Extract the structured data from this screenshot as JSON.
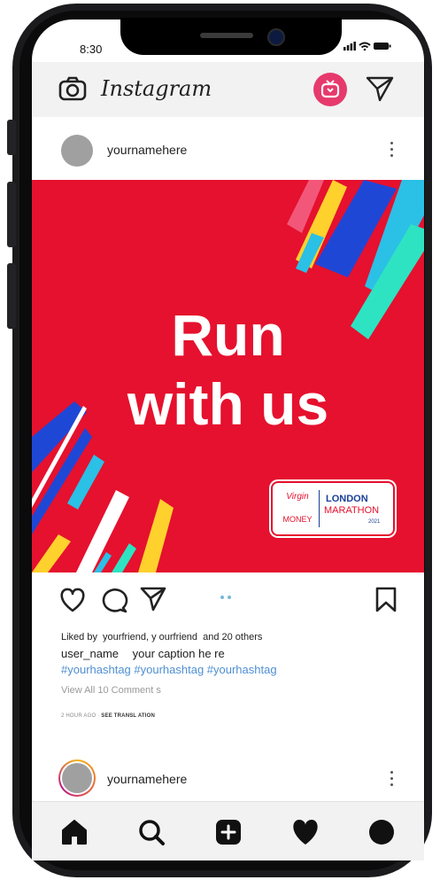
{
  "status": {
    "time": "8:30"
  },
  "app": {
    "title": "Instagram",
    "brand_color": "#e63a6c"
  },
  "post": {
    "username": "yournamehere",
    "poster_line1": "Run",
    "poster_line2": "with us",
    "poster_bg": "#e5112e",
    "badge": {
      "virgin": "Virgin",
      "money": "MONEY",
      "london": "LONDON",
      "marathon": "MARATHON",
      "year": "2021"
    },
    "liked_prefix": "Liked by",
    "liked_user": "yourfriend, y  ourfriend",
    "liked_suffix": "and 20 others",
    "caption_user": "user_name",
    "caption_text": "your caption he  re",
    "hashtags": "#yourhashtag #yourhashtag #yourhashtag",
    "view_comments": "View All 10 Comment  s",
    "time_ago": "2 HOUR  AGO",
    "see_translation": "SEE TRANSL    ATION"
  },
  "next_post": {
    "username": "yournamehere"
  },
  "nav": {
    "items": [
      "home-icon",
      "search-icon",
      "add-icon",
      "heart-icon",
      "profile-icon"
    ]
  }
}
